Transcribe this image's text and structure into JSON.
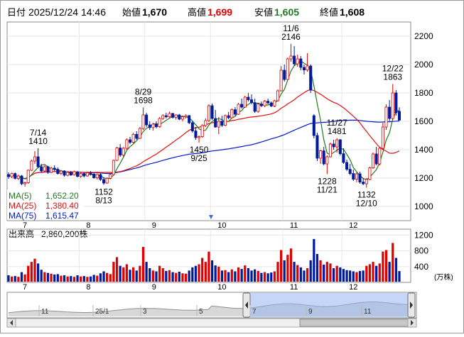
{
  "header": {
    "date_label": "日付",
    "datetime": "2025/12/24 14:46",
    "open_label": "始値",
    "open_value": "1,670",
    "high_label": "高値",
    "high_value": "1,699",
    "low_label": "安値",
    "low_value": "1,605",
    "close_label": "終値",
    "close_value": "1,608"
  },
  "colors": {
    "up": "#e00000",
    "down": "#001a9c",
    "ma5": "#207a20",
    "ma25": "#e01010",
    "ma75": "#0018c8",
    "volume_up": "#e00000",
    "volume_down": "#001a9c",
    "navigator_fill": "#98b4f0"
  },
  "legend": [
    {
      "label": "MA(5)",
      "value": "1,652.20"
    },
    {
      "label": "MA(25)",
      "value": "1,380.40"
    },
    {
      "label": "MA(75)",
      "value": "1,615.47"
    }
  ],
  "volume_label": "出来高",
  "volume_value": "2,860,200株",
  "volume_unit": "(万株)",
  "chart_data": {
    "type": "candlestick",
    "price_ylim": [
      900,
      2300
    ],
    "price_ticks": [
      "2200",
      "2000",
      "1800",
      "1600",
      "1400",
      "1200",
      "1000"
    ],
    "volume_ylim": [
      0,
      1350
    ],
    "volume_ticks": [
      "1200",
      "800",
      "400"
    ],
    "month_labels": [
      "7",
      "8",
      "9",
      "10",
      "11",
      "12"
    ],
    "annotations": [
      {
        "date": "7/14",
        "value": "1410"
      },
      {
        "date": "8/13",
        "value": "1152"
      },
      {
        "date": "8/29",
        "value": "1698"
      },
      {
        "date": "9/25",
        "value": "1450"
      },
      {
        "date": "11/6",
        "value": "2146"
      },
      {
        "date": "11/21",
        "value": "1228"
      },
      {
        "date": "11/27",
        "value": "1481"
      },
      {
        "date": "12/10",
        "value": "1132"
      },
      {
        "date": "12/22",
        "value": "1863"
      }
    ],
    "candles": [
      {
        "d": "7/1",
        "o": 1225,
        "h": 1240,
        "l": 1195,
        "c": 1210,
        "v": 180
      },
      {
        "d": "7/2",
        "o": 1210,
        "h": 1238,
        "l": 1200,
        "c": 1232,
        "v": 150
      },
      {
        "d": "7/3",
        "o": 1232,
        "h": 1240,
        "l": 1190,
        "c": 1198,
        "v": 160
      },
      {
        "d": "7/4",
        "o": 1198,
        "h": 1225,
        "l": 1185,
        "c": 1215,
        "v": 140
      },
      {
        "d": "7/7",
        "o": 1215,
        "h": 1222,
        "l": 1150,
        "c": 1160,
        "v": 260
      },
      {
        "d": "7/8",
        "o": 1160,
        "h": 1175,
        "l": 1140,
        "c": 1168,
        "v": 200
      },
      {
        "d": "7/9",
        "o": 1168,
        "h": 1260,
        "l": 1160,
        "c": 1255,
        "v": 420
      },
      {
        "d": "7/10",
        "o": 1255,
        "h": 1330,
        "l": 1250,
        "c": 1320,
        "v": 520
      },
      {
        "d": "7/11",
        "o": 1320,
        "h": 1390,
        "l": 1300,
        "c": 1350,
        "v": 600
      },
      {
        "d": "7/14",
        "o": 1350,
        "h": 1410,
        "l": 1270,
        "c": 1280,
        "v": 480
      },
      {
        "d": "7/15",
        "o": 1280,
        "h": 1300,
        "l": 1240,
        "c": 1250,
        "v": 320
      },
      {
        "d": "7/16",
        "o": 1250,
        "h": 1290,
        "l": 1240,
        "c": 1280,
        "v": 260
      },
      {
        "d": "7/17",
        "o": 1280,
        "h": 1285,
        "l": 1230,
        "c": 1240,
        "v": 240
      },
      {
        "d": "7/18",
        "o": 1240,
        "h": 1280,
        "l": 1235,
        "c": 1270,
        "v": 220
      },
      {
        "d": "7/22",
        "o": 1270,
        "h": 1290,
        "l": 1250,
        "c": 1262,
        "v": 200
      },
      {
        "d": "7/23",
        "o": 1262,
        "h": 1275,
        "l": 1225,
        "c": 1232,
        "v": 210
      },
      {
        "d": "7/24",
        "o": 1232,
        "h": 1258,
        "l": 1222,
        "c": 1250,
        "v": 170
      },
      {
        "d": "7/25",
        "o": 1250,
        "h": 1255,
        "l": 1210,
        "c": 1220,
        "v": 180
      },
      {
        "d": "7/28",
        "o": 1220,
        "h": 1248,
        "l": 1212,
        "c": 1240,
        "v": 150
      },
      {
        "d": "7/29",
        "o": 1240,
        "h": 1250,
        "l": 1215,
        "c": 1222,
        "v": 160
      },
      {
        "d": "7/30",
        "o": 1222,
        "h": 1252,
        "l": 1218,
        "c": 1245,
        "v": 140
      },
      {
        "d": "7/31",
        "o": 1245,
        "h": 1248,
        "l": 1205,
        "c": 1212,
        "v": 180
      },
      {
        "d": "8/1",
        "o": 1212,
        "h": 1240,
        "l": 1200,
        "c": 1232,
        "v": 150
      },
      {
        "d": "8/4",
        "o": 1232,
        "h": 1238,
        "l": 1205,
        "c": 1215,
        "v": 160
      },
      {
        "d": "8/5",
        "o": 1215,
        "h": 1245,
        "l": 1210,
        "c": 1238,
        "v": 140
      },
      {
        "d": "8/6",
        "o": 1238,
        "h": 1250,
        "l": 1218,
        "c": 1228,
        "v": 150
      },
      {
        "d": "8/7",
        "o": 1228,
        "h": 1242,
        "l": 1196,
        "c": 1202,
        "v": 190
      },
      {
        "d": "8/8",
        "o": 1202,
        "h": 1232,
        "l": 1190,
        "c": 1225,
        "v": 170
      },
      {
        "d": "8/12",
        "o": 1225,
        "h": 1232,
        "l": 1180,
        "c": 1190,
        "v": 230
      },
      {
        "d": "8/13",
        "o": 1190,
        "h": 1205,
        "l": 1152,
        "c": 1165,
        "v": 280
      },
      {
        "d": "8/14",
        "o": 1165,
        "h": 1205,
        "l": 1160,
        "c": 1198,
        "v": 240
      },
      {
        "d": "8/15",
        "o": 1198,
        "h": 1232,
        "l": 1190,
        "c": 1225,
        "v": 210
      },
      {
        "d": "8/18",
        "o": 1225,
        "h": 1330,
        "l": 1218,
        "c": 1325,
        "v": 520
      },
      {
        "d": "8/19",
        "o": 1325,
        "h": 1420,
        "l": 1320,
        "c": 1412,
        "v": 640
      },
      {
        "d": "8/20",
        "o": 1412,
        "h": 1440,
        "l": 1350,
        "c": 1362,
        "v": 420
      },
      {
        "d": "8/21",
        "o": 1362,
        "h": 1420,
        "l": 1350,
        "c": 1410,
        "v": 380
      },
      {
        "d": "8/22",
        "o": 1410,
        "h": 1480,
        "l": 1400,
        "c": 1470,
        "v": 460
      },
      {
        "d": "8/25",
        "o": 1470,
        "h": 1490,
        "l": 1440,
        "c": 1452,
        "v": 320
      },
      {
        "d": "8/26",
        "o": 1452,
        "h": 1520,
        "l": 1445,
        "c": 1508,
        "v": 380
      },
      {
        "d": "8/27",
        "o": 1508,
        "h": 1530,
        "l": 1470,
        "c": 1480,
        "v": 300
      },
      {
        "d": "8/28",
        "o": 1480,
        "h": 1560,
        "l": 1475,
        "c": 1550,
        "v": 420
      },
      {
        "d": "8/29",
        "o": 1550,
        "h": 1698,
        "l": 1540,
        "c": 1645,
        "v": 900
      },
      {
        "d": "9/1",
        "o": 1645,
        "h": 1660,
        "l": 1560,
        "c": 1575,
        "v": 520
      },
      {
        "d": "9/2",
        "o": 1575,
        "h": 1600,
        "l": 1540,
        "c": 1556,
        "v": 360
      },
      {
        "d": "9/3",
        "o": 1556,
        "h": 1590,
        "l": 1535,
        "c": 1580,
        "v": 300
      },
      {
        "d": "9/4",
        "o": 1580,
        "h": 1600,
        "l": 1550,
        "c": 1562,
        "v": 280
      },
      {
        "d": "9/5",
        "o": 1562,
        "h": 1630,
        "l": 1555,
        "c": 1620,
        "v": 420
      },
      {
        "d": "9/8",
        "o": 1620,
        "h": 1650,
        "l": 1610,
        "c": 1640,
        "v": 360
      },
      {
        "d": "9/9",
        "o": 1640,
        "h": 1660,
        "l": 1620,
        "c": 1632,
        "v": 290
      },
      {
        "d": "9/10",
        "o": 1632,
        "h": 1668,
        "l": 1626,
        "c": 1655,
        "v": 310
      },
      {
        "d": "9/11",
        "o": 1655,
        "h": 1660,
        "l": 1620,
        "c": 1628,
        "v": 260
      },
      {
        "d": "9/12",
        "o": 1628,
        "h": 1650,
        "l": 1612,
        "c": 1645,
        "v": 240
      },
      {
        "d": "9/16",
        "o": 1645,
        "h": 1652,
        "l": 1608,
        "c": 1615,
        "v": 270
      },
      {
        "d": "9/17",
        "o": 1615,
        "h": 1640,
        "l": 1600,
        "c": 1632,
        "v": 230
      },
      {
        "d": "9/18",
        "o": 1632,
        "h": 1650,
        "l": 1620,
        "c": 1640,
        "v": 220
      },
      {
        "d": "9/19",
        "o": 1640,
        "h": 1645,
        "l": 1580,
        "c": 1590,
        "v": 300
      },
      {
        "d": "9/22",
        "o": 1590,
        "h": 1600,
        "l": 1520,
        "c": 1532,
        "v": 380
      },
      {
        "d": "9/24",
        "o": 1532,
        "h": 1560,
        "l": 1470,
        "c": 1485,
        "v": 420
      },
      {
        "d": "9/25",
        "o": 1485,
        "h": 1500,
        "l": 1450,
        "c": 1492,
        "v": 460
      },
      {
        "d": "9/26",
        "o": 1492,
        "h": 1580,
        "l": 1485,
        "c": 1570,
        "v": 620
      },
      {
        "d": "9/29",
        "o": 1570,
        "h": 1620,
        "l": 1560,
        "c": 1605,
        "v": 520
      },
      {
        "d": "9/30",
        "o": 1605,
        "h": 1720,
        "l": 1595,
        "c": 1710,
        "v": 780
      },
      {
        "d": "10/1",
        "o": 1710,
        "h": 1725,
        "l": 1610,
        "c": 1620,
        "v": 560
      },
      {
        "d": "10/2",
        "o": 1620,
        "h": 1680,
        "l": 1555,
        "c": 1560,
        "v": 430
      },
      {
        "d": "10/3",
        "o": 1560,
        "h": 1630,
        "l": 1510,
        "c": 1600,
        "v": 400
      },
      {
        "d": "10/6",
        "o": 1600,
        "h": 1640,
        "l": 1560,
        "c": 1572,
        "v": 300
      },
      {
        "d": "10/7",
        "o": 1572,
        "h": 1648,
        "l": 1565,
        "c": 1640,
        "v": 310
      },
      {
        "d": "10/8",
        "o": 1640,
        "h": 1665,
        "l": 1615,
        "c": 1625,
        "v": 260
      },
      {
        "d": "10/9",
        "o": 1625,
        "h": 1690,
        "l": 1620,
        "c": 1682,
        "v": 330
      },
      {
        "d": "10/10",
        "o": 1682,
        "h": 1700,
        "l": 1640,
        "c": 1650,
        "v": 280
      },
      {
        "d": "10/14",
        "o": 1650,
        "h": 1730,
        "l": 1645,
        "c": 1720,
        "v": 380
      },
      {
        "d": "10/15",
        "o": 1720,
        "h": 1760,
        "l": 1690,
        "c": 1700,
        "v": 340
      },
      {
        "d": "10/16",
        "o": 1700,
        "h": 1780,
        "l": 1695,
        "c": 1770,
        "v": 430
      },
      {
        "d": "10/17",
        "o": 1770,
        "h": 1800,
        "l": 1740,
        "c": 1752,
        "v": 360
      },
      {
        "d": "10/20",
        "o": 1752,
        "h": 1790,
        "l": 1720,
        "c": 1732,
        "v": 300
      },
      {
        "d": "10/21",
        "o": 1732,
        "h": 1760,
        "l": 1660,
        "c": 1670,
        "v": 330
      },
      {
        "d": "10/22",
        "o": 1670,
        "h": 1730,
        "l": 1660,
        "c": 1722,
        "v": 290
      },
      {
        "d": "10/23",
        "o": 1722,
        "h": 1740,
        "l": 1700,
        "c": 1710,
        "v": 240
      },
      {
        "d": "10/24",
        "o": 1710,
        "h": 1750,
        "l": 1700,
        "c": 1742,
        "v": 260
      },
      {
        "d": "10/27",
        "o": 1742,
        "h": 1760,
        "l": 1720,
        "c": 1730,
        "v": 230
      },
      {
        "d": "10/28",
        "o": 1730,
        "h": 1740,
        "l": 1700,
        "c": 1708,
        "v": 250
      },
      {
        "d": "10/29",
        "o": 1708,
        "h": 1752,
        "l": 1700,
        "c": 1745,
        "v": 280
      },
      {
        "d": "10/30",
        "o": 1745,
        "h": 1825,
        "l": 1740,
        "c": 1815,
        "v": 520
      },
      {
        "d": "10/31",
        "o": 1815,
        "h": 1990,
        "l": 1810,
        "c": 1960,
        "v": 820
      },
      {
        "d": "11/4",
        "o": 1960,
        "h": 2000,
        "l": 1880,
        "c": 1895,
        "v": 560
      },
      {
        "d": "11/5",
        "o": 1895,
        "h": 2050,
        "l": 1890,
        "c": 2040,
        "v": 700
      },
      {
        "d": "11/6",
        "o": 2040,
        "h": 2146,
        "l": 2020,
        "c": 2060,
        "v": 860
      },
      {
        "d": "11/7",
        "o": 2060,
        "h": 2130,
        "l": 1990,
        "c": 2005,
        "v": 520
      },
      {
        "d": "11/10",
        "o": 2005,
        "h": 2070,
        "l": 1985,
        "c": 2040,
        "v": 440
      },
      {
        "d": "11/11",
        "o": 2040,
        "h": 2060,
        "l": 1960,
        "c": 1980,
        "v": 380
      },
      {
        "d": "11/12",
        "o": 1980,
        "h": 2000,
        "l": 1930,
        "c": 1962,
        "v": 300
      },
      {
        "d": "11/13",
        "o": 1962,
        "h": 2080,
        "l": 1950,
        "c": 1990,
        "v": 360
      },
      {
        "d": "11/14",
        "o": 1990,
        "h": 2000,
        "l": 1800,
        "c": 1820,
        "v": 560
      },
      {
        "d": "11/17",
        "o": 1640,
        "h": 1650,
        "l": 1480,
        "c": 1500,
        "v": 1100
      },
      {
        "d": "11/18",
        "o": 1500,
        "h": 1520,
        "l": 1320,
        "c": 1340,
        "v": 720
      },
      {
        "d": "11/19",
        "o": 1340,
        "h": 1400,
        "l": 1300,
        "c": 1392,
        "v": 560
      },
      {
        "d": "11/20",
        "o": 1392,
        "h": 1420,
        "l": 1290,
        "c": 1300,
        "v": 450
      },
      {
        "d": "11/21",
        "o": 1300,
        "h": 1360,
        "l": 1228,
        "c": 1350,
        "v": 520
      },
      {
        "d": "11/25",
        "o": 1350,
        "h": 1450,
        "l": 1345,
        "c": 1440,
        "v": 480
      },
      {
        "d": "11/26",
        "o": 1440,
        "h": 1470,
        "l": 1400,
        "c": 1420,
        "v": 360
      },
      {
        "d": "11/27",
        "o": 1420,
        "h": 1481,
        "l": 1380,
        "c": 1470,
        "v": 420
      },
      {
        "d": "11/28",
        "o": 1470,
        "h": 1475,
        "l": 1360,
        "c": 1372,
        "v": 380
      },
      {
        "d": "12/1",
        "o": 1372,
        "h": 1410,
        "l": 1300,
        "c": 1310,
        "v": 340
      },
      {
        "d": "12/2",
        "o": 1310,
        "h": 1330,
        "l": 1250,
        "c": 1262,
        "v": 310
      },
      {
        "d": "12/3",
        "o": 1262,
        "h": 1300,
        "l": 1220,
        "c": 1232,
        "v": 300
      },
      {
        "d": "12/4",
        "o": 1232,
        "h": 1260,
        "l": 1180,
        "c": 1192,
        "v": 280
      },
      {
        "d": "12/5",
        "o": 1192,
        "h": 1240,
        "l": 1170,
        "c": 1230,
        "v": 260
      },
      {
        "d": "12/8",
        "o": 1230,
        "h": 1245,
        "l": 1160,
        "c": 1172,
        "v": 290
      },
      {
        "d": "12/9",
        "o": 1172,
        "h": 1200,
        "l": 1150,
        "c": 1160,
        "v": 300
      },
      {
        "d": "12/10",
        "o": 1160,
        "h": 1200,
        "l": 1132,
        "c": 1190,
        "v": 420
      },
      {
        "d": "12/11",
        "o": 1190,
        "h": 1280,
        "l": 1185,
        "c": 1272,
        "v": 460
      },
      {
        "d": "12/12",
        "o": 1272,
        "h": 1380,
        "l": 1265,
        "c": 1370,
        "v": 520
      },
      {
        "d": "12/15",
        "o": 1370,
        "h": 1420,
        "l": 1290,
        "c": 1300,
        "v": 420
      },
      {
        "d": "12/16",
        "o": 1300,
        "h": 1420,
        "l": 1290,
        "c": 1410,
        "v": 480
      },
      {
        "d": "12/17",
        "o": 1410,
        "h": 1590,
        "l": 1400,
        "c": 1560,
        "v": 780
      },
      {
        "d": "12/18",
        "o": 1560,
        "h": 1720,
        "l": 1540,
        "c": 1700,
        "v": 820
      },
      {
        "d": "12/19",
        "o": 1700,
        "h": 1750,
        "l": 1600,
        "c": 1620,
        "v": 520
      },
      {
        "d": "12/22",
        "o": 1620,
        "h": 1863,
        "l": 1610,
        "c": 1800,
        "v": 1000
      },
      {
        "d": "12/23",
        "o": 1800,
        "h": 1820,
        "l": 1640,
        "c": 1660,
        "v": 620
      },
      {
        "d": "12/24",
        "o": 1670,
        "h": 1699,
        "l": 1605,
        "c": 1608,
        "v": 286
      }
    ]
  },
  "navigator": {
    "labels": [
      "11",
      "25/1",
      "3",
      "5",
      "7",
      "9",
      "11"
    ]
  }
}
